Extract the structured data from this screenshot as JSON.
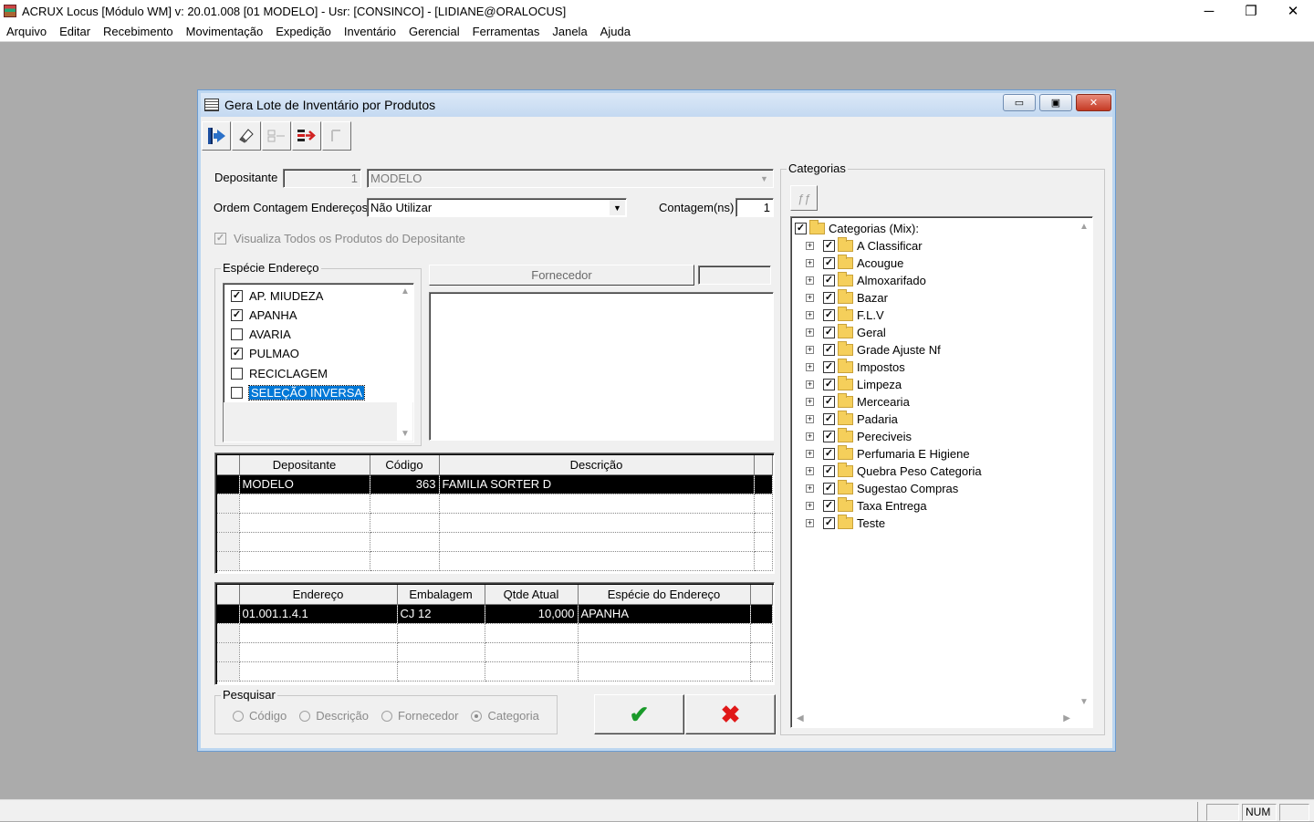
{
  "app": {
    "title": "ACRUX Locus [Módulo WM]  v: 20.01.008   [01 MODELO] - Usr: [CONSINCO] - [LIDIANE@ORALOCUS]"
  },
  "window_controls": {
    "minimize": "─",
    "restore": "❐",
    "close": "✕"
  },
  "menu": [
    "Arquivo",
    "Editar",
    "Recebimento",
    "Movimentação",
    "Expedição",
    "Inventário",
    "Gerencial",
    "Ferramentas",
    "Janela",
    "Ajuda"
  ],
  "dialog": {
    "title": "Gera Lote de Inventário por Produtos",
    "controls": {
      "minimize": "▭",
      "restore": "▣",
      "close": "✕"
    },
    "depositante": {
      "label": "Depositante",
      "code": "1",
      "name": "MODELO"
    },
    "ordem": {
      "label": "Ordem Contagem Endereços",
      "value": "Não Utilizar"
    },
    "contagem": {
      "label": "Contagem(ns)",
      "value": "1"
    },
    "visualiza": {
      "label": "Visualiza Todos os Produtos do Depositante",
      "checked": true
    },
    "especie": {
      "label": "Espécie Endereço",
      "items": [
        {
          "label": "AP. MIUDEZA",
          "checked": true
        },
        {
          "label": "APANHA",
          "checked": true
        },
        {
          "label": "AVARIA",
          "checked": false
        },
        {
          "label": "PULMAO",
          "checked": true
        },
        {
          "label": "RECICLAGEM",
          "checked": false
        },
        {
          "label": "SELEÇÃO INVERSA",
          "checked": false,
          "selected": true
        }
      ]
    },
    "fornecedor": {
      "label": "Fornecedor"
    },
    "grid1": {
      "headers": [
        "Depositante",
        "Código",
        "Descrição"
      ],
      "rows": [
        [
          "MODELO",
          "363",
          "FAMILIA SORTER D"
        ]
      ]
    },
    "grid2": {
      "headers": [
        "Endereço",
        "Embalagem",
        "Qtde Atual",
        "Espécie do Endereço"
      ],
      "rows": [
        [
          "01.001.1.4.1",
          "CJ 12",
          "10,000",
          "APANHA"
        ]
      ]
    },
    "pesquisar": {
      "label": "Pesquisar",
      "options": [
        {
          "label": "Código",
          "selected": false
        },
        {
          "label": "Descrição",
          "selected": false
        },
        {
          "label": "Fornecedor",
          "selected": false
        },
        {
          "label": "Categoria",
          "selected": true
        }
      ]
    },
    "ok_glyph": "✔",
    "cancel_glyph": "✖",
    "categorias": {
      "label": "Categorias",
      "root": "Categorias (Mix):",
      "items": [
        "A Classificar",
        "Acougue",
        "Almoxarifado",
        "Bazar",
        "F.L.V",
        "Geral",
        "Grade Ajuste Nf",
        "Impostos",
        "Limpeza",
        "Mercearia",
        "Padaria",
        "Pereciveis",
        "Perfumaria E Higiene",
        "Quebra Peso Categoria",
        "Sugestao Compras",
        "Taxa Entrega",
        "Teste"
      ]
    }
  },
  "status": {
    "num": "NUM"
  },
  "colors": {
    "ok": "#1a9a2a",
    "cancel": "#e01818",
    "selection": "#0078d7"
  }
}
